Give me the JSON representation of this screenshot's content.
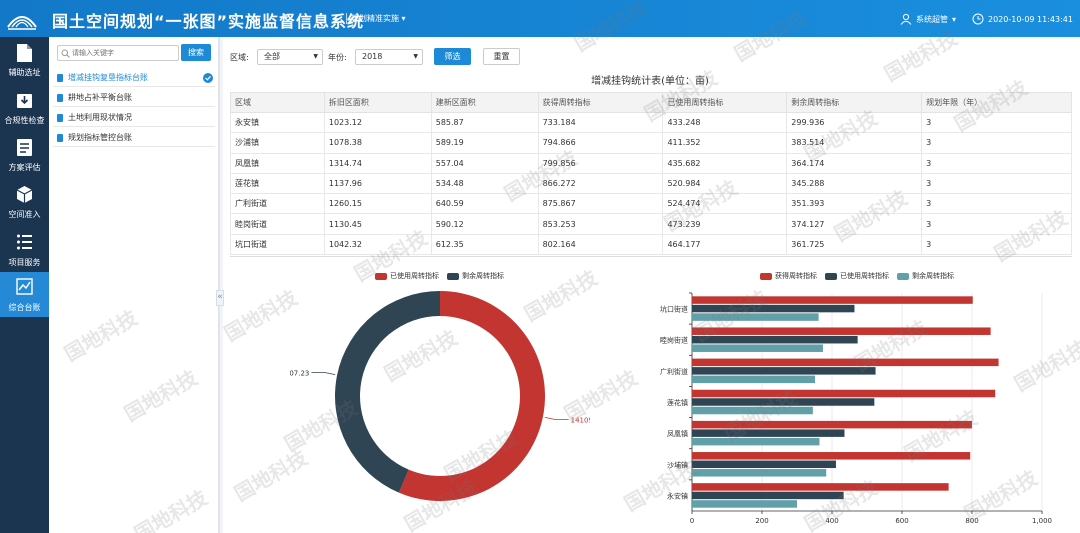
{
  "header": {
    "title": "国土空间规划“一张图”实施监督信息系统",
    "module": "规划精准实施",
    "user": "系统超管",
    "datetime": "2020-10-09  11:43:41"
  },
  "sidebar": {
    "items": [
      {
        "label": "辅助选址",
        "icon": "document-icon"
      },
      {
        "label": "合规性检查",
        "icon": "download-box-icon"
      },
      {
        "label": "方案评估",
        "icon": "report-icon"
      },
      {
        "label": "空间准入",
        "icon": "cube-icon"
      },
      {
        "label": "项目服务",
        "icon": "list-icon"
      },
      {
        "label": "综合台账",
        "icon": "chart-line-icon"
      }
    ],
    "active_index": 5
  },
  "left_panel": {
    "search_placeholder": "请输入关键字",
    "search_button": "搜索",
    "tree_items": [
      {
        "label": "增减挂钩复垦指标台账",
        "active": true
      },
      {
        "label": "耕地占补平衡台账",
        "active": false
      },
      {
        "label": "土地利用现状情况",
        "active": false
      },
      {
        "label": "规划指标管控台账",
        "active": false
      }
    ]
  },
  "filters": {
    "region_label": "区域:",
    "region_value": "全部",
    "year_label": "年份:",
    "year_value": "2018",
    "filter_button": "筛选",
    "reset_button": "重置"
  },
  "table": {
    "title": "增减挂钩统计表(单位：亩)",
    "columns": [
      "区域",
      "拆旧区面积",
      "建新区面积",
      "获得周转指标",
      "已使用周转指标",
      "剩余周转指标",
      "规划年限（年）"
    ],
    "rows": [
      [
        "永安镇",
        "1023.12",
        "585.87",
        "733.184",
        "433.248",
        "299.936",
        "3"
      ],
      [
        "沙浦镇",
        "1078.38",
        "589.19",
        "794.866",
        "411.352",
        "383.514",
        "3"
      ],
      [
        "凤凰镇",
        "1314.74",
        "557.04",
        "799.856",
        "435.682",
        "364.174",
        "3"
      ],
      [
        "莲花镇",
        "1137.96",
        "534.48",
        "866.272",
        "520.984",
        "345.288",
        "3"
      ],
      [
        "广利街道",
        "1260.15",
        "640.59",
        "875.867",
        "524.474",
        "351.393",
        "3"
      ],
      [
        "睦岗街道",
        "1130.45",
        "590.12",
        "853.253",
        "473.239",
        "374.127",
        "3"
      ],
      [
        "坑口街道",
        "1042.32",
        "612.35",
        "802.164",
        "464.177",
        "361.725",
        "3"
      ]
    ]
  },
  "colors": {
    "red": "#c23531",
    "dark": "#2f4554",
    "teal": "#61a0a8",
    "header": "#1a86d6",
    "sidebar": "#1b3450"
  },
  "chart_data": [
    {
      "type": "pie",
      "variant": "donut",
      "legend": [
        "已使用周转指标",
        "剩余周转指标"
      ],
      "values": [
        14109.63,
        10907.23
      ],
      "data_labels": [
        "14109.63",
        "10907.23"
      ]
    },
    {
      "type": "bar",
      "orientation": "horizontal",
      "categories": [
        "永安镇",
        "沙埔镇",
        "凤凰镇",
        "莲花镇",
        "广利街道",
        "睦岗街道",
        "坑口街道"
      ],
      "series": [
        {
          "name": "获得周转指标",
          "values": [
            733.184,
            794.866,
            799.856,
            866.272,
            875.867,
            853.253,
            802.164
          ]
        },
        {
          "name": "已使用周转指标",
          "values": [
            433.248,
            411.352,
            435.682,
            520.984,
            524.474,
            473.239,
            464.177
          ]
        },
        {
          "name": "剩余周转指标",
          "values": [
            299.936,
            383.514,
            364.174,
            345.288,
            351.393,
            374.127,
            361.725
          ]
        }
      ],
      "xlim": [
        0,
        1000
      ],
      "xticks": [
        "0",
        "200",
        "400",
        "600",
        "800",
        "1,000"
      ],
      "grid": true,
      "legend_position": "top"
    }
  ],
  "watermark": "国地科技"
}
